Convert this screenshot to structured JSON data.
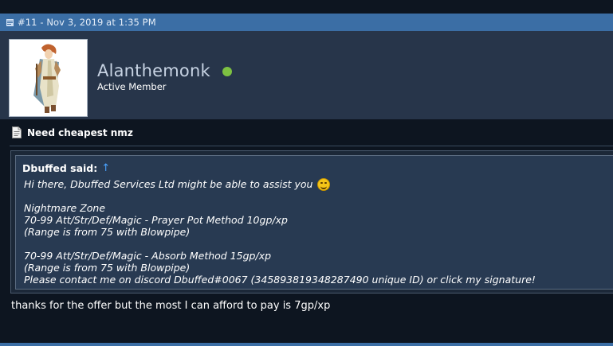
{
  "post": {
    "number_date": "#11 - Nov 3, 2019 at 1:35 PM"
  },
  "user": {
    "username": "Alanthemonk",
    "title": "Active Member",
    "online": true,
    "online_color": "#7dc142"
  },
  "thread": {
    "title": "Need cheapest nmz"
  },
  "quote": {
    "author": "Dbuffed said:",
    "arrow": "↑",
    "lines": [
      "Hi there, Dbuffed Services Ltd might be able to assist you",
      "",
      "Nightmare Zone",
      "70-99 Att/Str/Def/Magic - Prayer Pot Method 10gp/xp",
      "(Range is from 75 with Blowpipe)",
      "",
      "70-99 Att/Str/Def/Magic - Absorb Method 15gp/xp",
      "(Range is from 75 with Blowpipe)",
      "Please contact me on discord Dbuffed#0067 (345893819348287490 unique ID) or click my signature!"
    ],
    "emoji": "grin-emoji"
  },
  "reply": {
    "text": "thanks for the offer but the most I can afford to pay is 7gp/xp"
  },
  "colors": {
    "header_bar": "#3b6ea5",
    "user_panel": "#27354a",
    "page_bg": "#0d1520",
    "quote_bg": "#283a52",
    "link_arrow": "#4aa3ff"
  }
}
